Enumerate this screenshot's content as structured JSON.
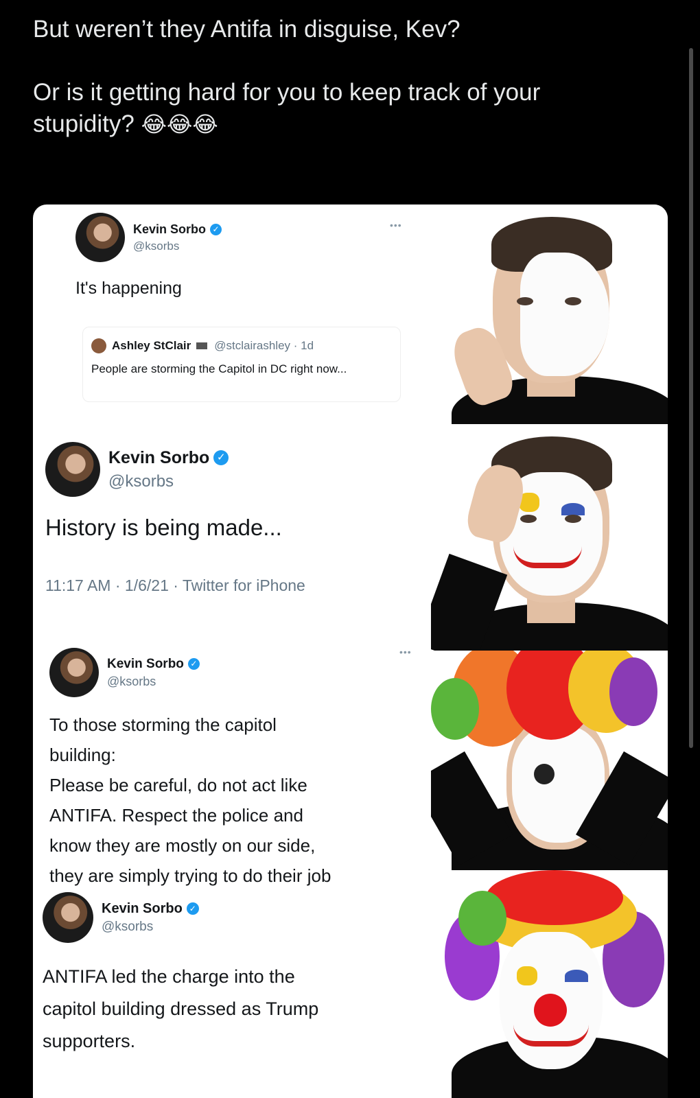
{
  "post": {
    "line1": "But weren’t they Antifa in disguise, Kev?",
    "line2": "Or is it getting hard for you to keep track of your",
    "line3": "stupidity?",
    "emojis": "😂😂😂"
  },
  "meme": {
    "panel1": {
      "name": "Kevin Sorbo",
      "handle": "@ksorbs",
      "text": "It's happening",
      "more": "•••",
      "quote": {
        "name": "Ashley StClair",
        "handle": "@stclairashley · 1d",
        "text": "People are storming the Capitol in DC right now..."
      }
    },
    "panel2": {
      "name": "Kevin Sorbo",
      "handle": "@ksorbs",
      "text": "History is being made...",
      "meta": "11:17 AM · 1/6/21 · Twitter for iPhone"
    },
    "panel3": {
      "name": "Kevin Sorbo",
      "handle": "@ksorbs",
      "more": "•••",
      "text_lines": [
        "To those storming the capitol",
        "building:",
        "Please be careful, do not act like",
        "ANTIFA. Respect the police and",
        "know they are mostly on our side,",
        "they are simply trying to do their job"
      ]
    },
    "panel4": {
      "name": "Kevin Sorbo",
      "handle": "@ksorbs",
      "text_lines": [
        "ANTIFA led the charge into the",
        "capitol building dressed as Trump",
        "supporters."
      ]
    }
  },
  "icons": {
    "verified": "verified-badge-icon",
    "more": "more-options-icon"
  },
  "colors": {
    "background": "#000000",
    "post_text": "#e7e9ea",
    "verified": "#1d9bf0",
    "handle": "#657786"
  }
}
